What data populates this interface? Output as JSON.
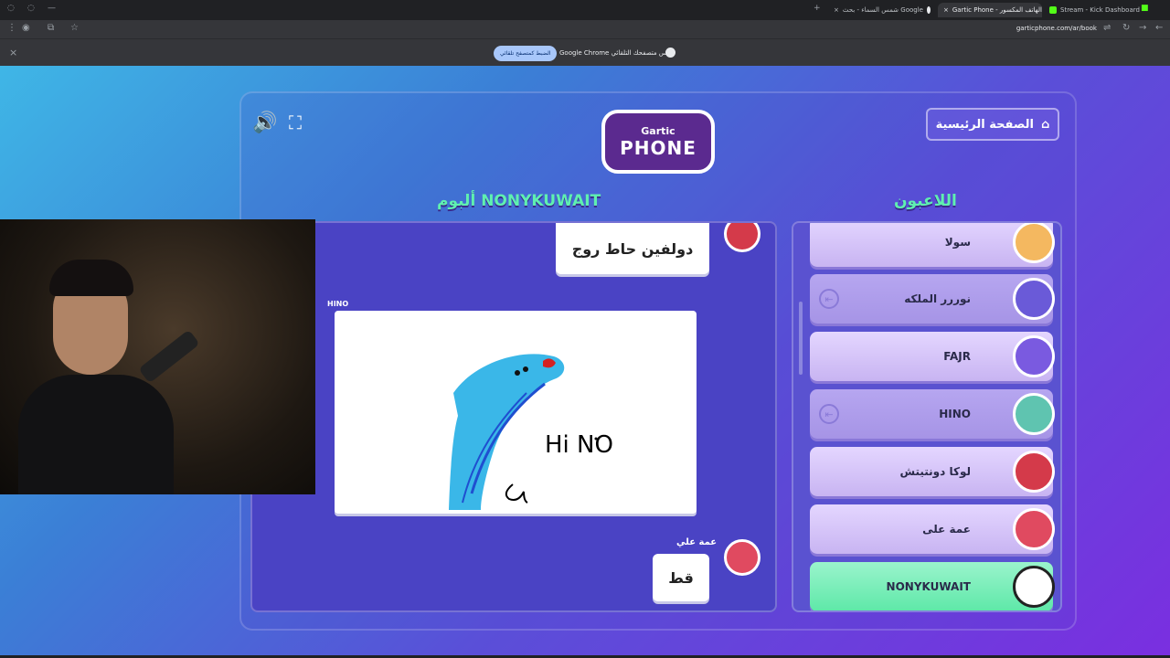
{
  "browser": {
    "tabs": [
      {
        "label": "Stream - Kick Dashboard",
        "color": "#53fc18"
      },
      {
        "label": "Gartic Phone - الهاتف المكسور",
        "color": "#8b5cf6",
        "active": true
      },
      {
        "label": "شمس السماء - بحث Google",
        "color": "#e8eaed"
      }
    ],
    "url": "garticphone.com/ar/book",
    "infobar_text": "Google Chrome ليس متصفحك التلقائي.",
    "infobar_button": "الضبط كمتصفح تلقائي"
  },
  "game": {
    "logo_small": "Gartic",
    "logo_big": "PHONE",
    "home_button": "الصفحة الرئيسية",
    "players_title": "اللاعبون",
    "album_title": "ألبوم NONYKUWAIT",
    "players": [
      {
        "name": "سولا",
        "state": "normal",
        "avatar_color": "#f4b860"
      },
      {
        "name": "نوررر الملكه",
        "state": "dim",
        "avatar_color": "#6a5ad8"
      },
      {
        "name": "FAJR",
        "state": "normal",
        "avatar_color": "#7a5ae0"
      },
      {
        "name": "HINO",
        "state": "dim",
        "avatar_color": "#5fc4b0"
      },
      {
        "name": "لوكا دونتيتش",
        "state": "normal",
        "avatar_color": "#d43a4a"
      },
      {
        "name": "عمة على",
        "state": "normal",
        "avatar_color": "#e04a60"
      },
      {
        "name": "NONYKUWAIT",
        "state": "me",
        "avatar_color": "#ffffff"
      }
    ],
    "album": {
      "first_text": "دولفين حاط روج",
      "drawing_author": "HINO",
      "drawing_text": "Hi NO",
      "last_author": "عمة علي",
      "last_text": "قط"
    },
    "colors": {
      "accent_green": "#5ff0b0",
      "stage_purple": "#5a4fd8"
    }
  }
}
